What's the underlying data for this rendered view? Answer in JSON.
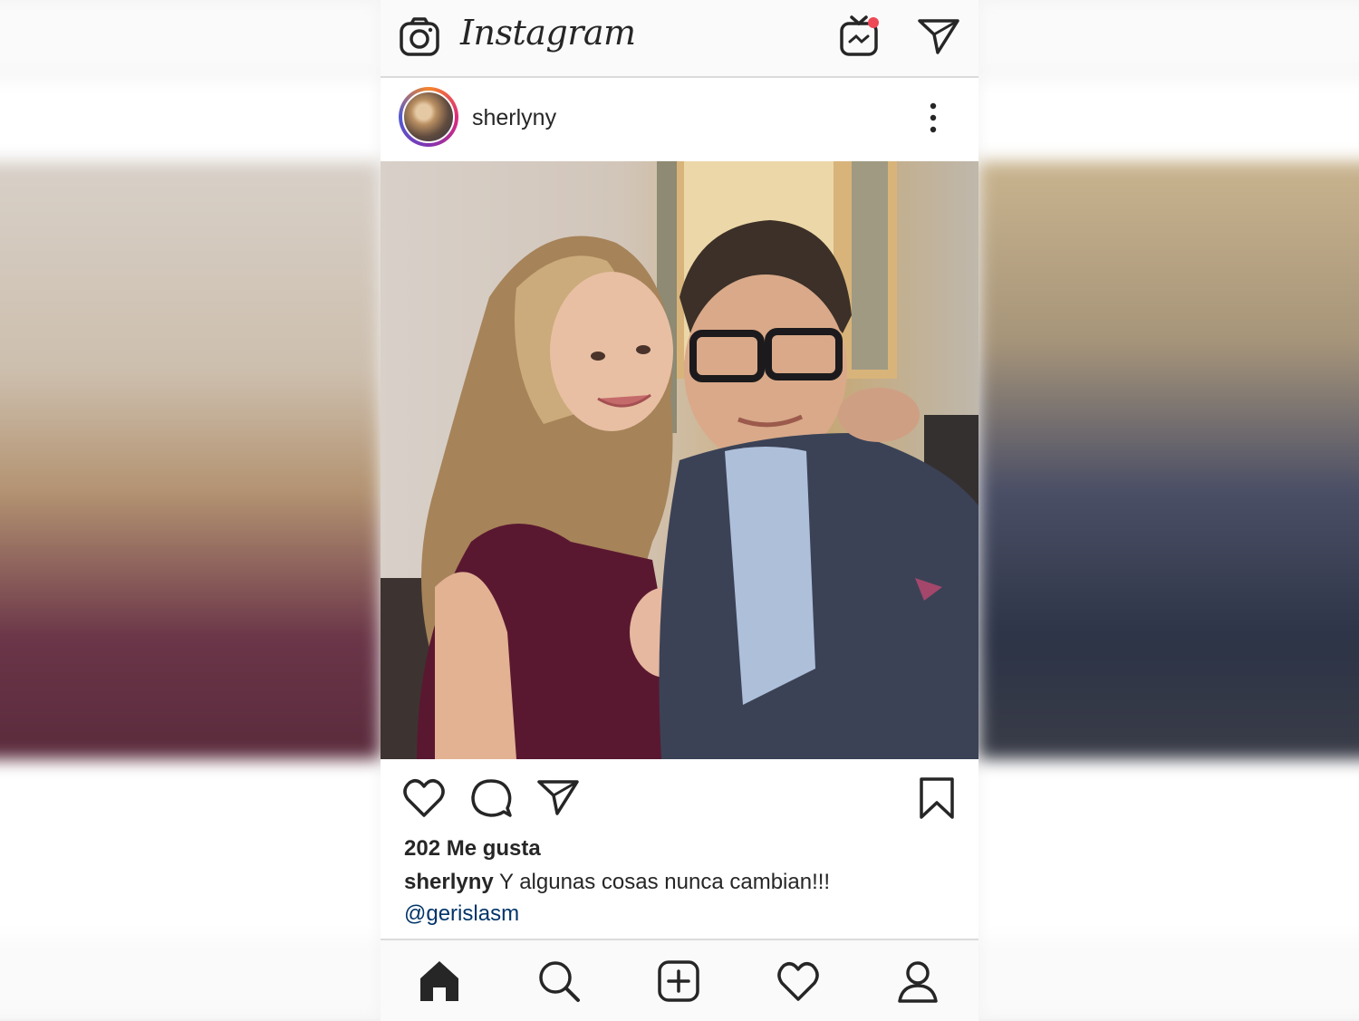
{
  "header": {
    "brand": "Instagram",
    "icons": [
      "camera-icon",
      "igtv-icon",
      "direct-message-icon"
    ],
    "notification_dot_color": "#ed4956"
  },
  "post": {
    "username": "sherlyny",
    "likes": "202 Me gusta",
    "caption_user": "sherlyny",
    "caption_text": " Y algunas cosas nunca cambian!!!",
    "mention": "@gerislasm",
    "actions": [
      "heart-icon",
      "comment-icon",
      "share-icon",
      "bookmark-icon"
    ]
  },
  "bottom_nav": [
    "home-icon",
    "search-icon",
    "new-post-icon",
    "activity-icon",
    "profile-icon"
  ],
  "colors": {
    "text": "#262626",
    "mention": "#003569",
    "bar_bg": "#fafafa",
    "divider": "#dbdbdb"
  }
}
